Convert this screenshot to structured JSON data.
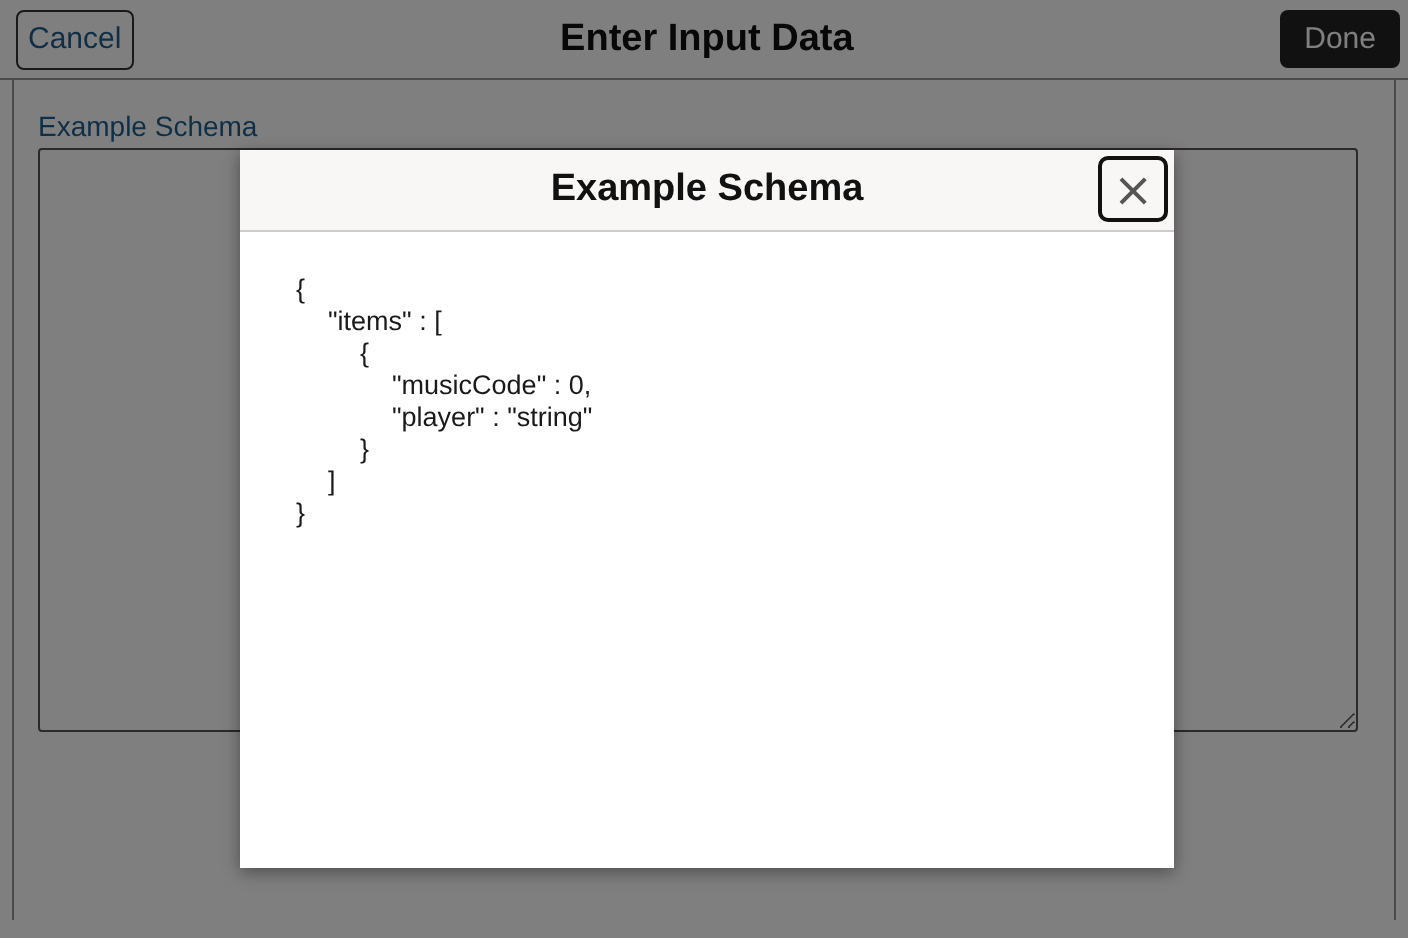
{
  "page": {
    "title": "Enter Input Data",
    "cancel_button": "Cancel",
    "done_button": "Done",
    "field_label": "Example Schema"
  },
  "modal": {
    "title": "Example Schema",
    "close_button": "×",
    "code_lines": [
      {
        "text": "{",
        "children": [
          {
            "text": "\"items\" : [",
            "children": [
              {
                "text": "{",
                "children": [
                  {
                    "text": "\"musicCode\" : 0,"
                  },
                  {
                    "text": "\"player\" : \"string\""
                  }
                ]
              },
              {
                "text": "}"
              }
            ]
          },
          {
            "text": "]"
          }
        ]
      },
      {
        "text": "}"
      }
    ]
  }
}
